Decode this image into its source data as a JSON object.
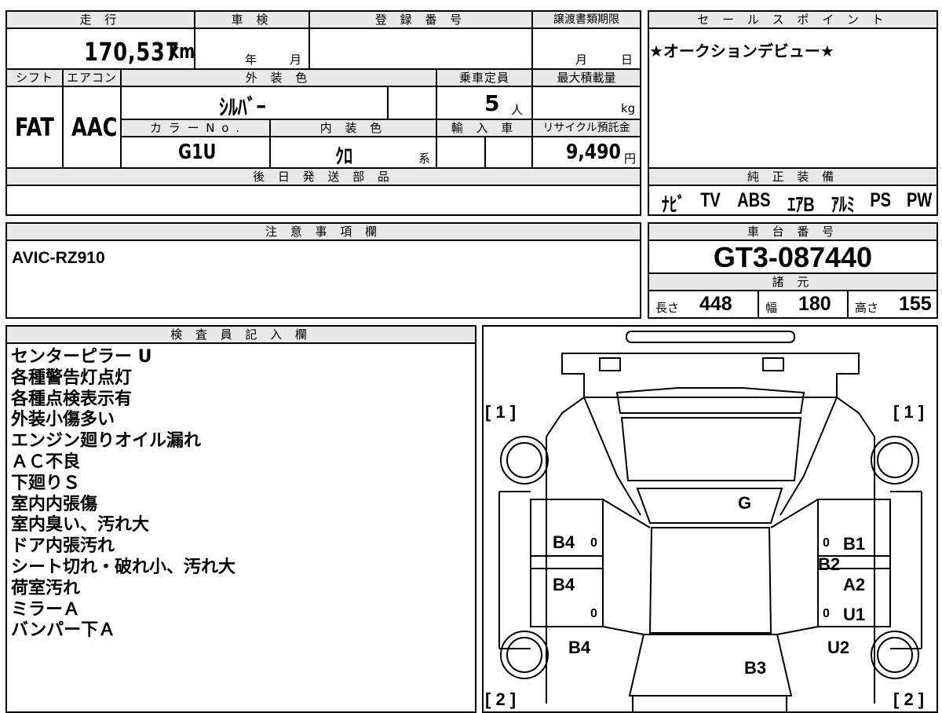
{
  "vehicle": {
    "mileage_label": "走 行",
    "mileage_value": "170,537",
    "mileage_unit": "km",
    "shaken_label": "車 検",
    "shaken_year": "年",
    "shaken_month": "月",
    "reg_label": "登 録 番 号",
    "transfer_label": "譲渡書類期限",
    "transfer_month": "月",
    "transfer_day": "日",
    "shift_label": "シフト",
    "shift_value": "FAT",
    "ac_label": "エアコン",
    "ac_value": "AAC",
    "exterior_label": "外 装 色",
    "exterior_value": "ｼﾙﾊﾞｰ",
    "capacity_label": "乗車定員",
    "capacity_value": "5",
    "capacity_unit": "人",
    "load_label": "最大積載量",
    "load_unit": "kg",
    "color_no_label": "カ ラ ー N o .",
    "color_no_value": "G1U",
    "interior_label": "内 装 色",
    "interior_value": "ｸﾛ",
    "interior_suffix": "系",
    "import_label": "輸 入 車",
    "recycle_label": "リサイクル預託金",
    "recycle_value": "9,490",
    "recycle_unit": "円",
    "parts_label": "後 日 発 送 部 品"
  },
  "sales": {
    "label": "セ ー ル ス ポ イ ン ト",
    "text": "★オークションデビュー★"
  },
  "equipment": {
    "label": "純 正 装 備",
    "items": [
      "ﾅﾋﾞ",
      "TV",
      "ABS",
      "ｴｱB",
      "ｱﾙﾐ",
      "PS",
      "PW"
    ]
  },
  "notes": {
    "label": "注 意 事 項 欄",
    "text": "AVIC-RZ910"
  },
  "chassis": {
    "label": "車 台 番 号",
    "value": "GT3-087440",
    "spec_label": "諸 元",
    "length_label": "長さ",
    "length_value": "448",
    "width_label": "幅",
    "width_value": "180",
    "height_label": "高さ",
    "height_value": "155"
  },
  "inspector": {
    "label": "検 査 員 記 入 欄",
    "lines": [
      "センターピラー U",
      "各種警告灯点灯",
      "各種点検表示有",
      "外装小傷多い",
      "エンジン廻りオイル漏れ",
      "ＡＣ不良",
      "下廻りＳ",
      "室内内張傷",
      "室内臭い、汚れ大",
      "ドア内張汚れ",
      "シート切れ・破れ小、汚れ大",
      "荷室汚れ",
      "ミラーＡ",
      "バンパー下Ａ"
    ]
  },
  "diagram": {
    "tire_labels": [
      "[ 1 ]",
      "[ 1 ]",
      "[ 2 ]",
      "[ 2 ]"
    ],
    "marks": [
      "G",
      "B4",
      "B4",
      "B4",
      "B1",
      "B2",
      "A2",
      "U1",
      "U2",
      "B3"
    ],
    "small_zero": "0"
  }
}
